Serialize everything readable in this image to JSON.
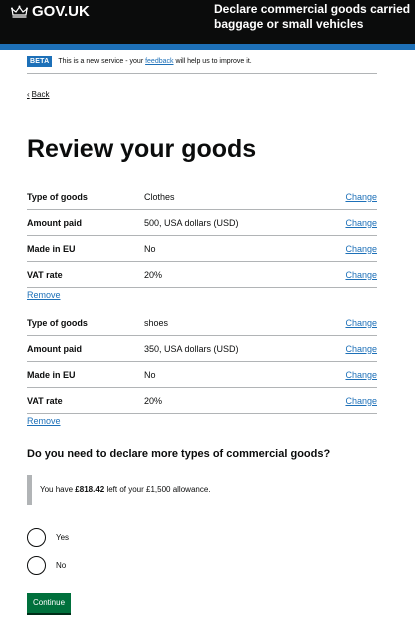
{
  "header": {
    "logo_text": "GOV.UK",
    "service_name_line1": "Declare commercial goods carried",
    "service_name_line2": "baggage or small vehicles"
  },
  "phase_banner": {
    "tag": "BETA",
    "text_before": "This is a new service - your ",
    "link": "feedback",
    "text_after": " will help us to improve it."
  },
  "back_link": "Back",
  "page_title": "Review your goods",
  "goods": [
    {
      "rows": [
        {
          "key": "Type of goods",
          "value": "Clothes",
          "action": "Change"
        },
        {
          "key": "Amount paid",
          "value": "500, USA dollars (USD)",
          "action": "Change"
        },
        {
          "key": "Made in EU",
          "value": "No",
          "action": "Change"
        },
        {
          "key": "VAT rate",
          "value": "20%",
          "action": "Change"
        }
      ],
      "remove": "Remove"
    },
    {
      "rows": [
        {
          "key": "Type of goods",
          "value": "shoes",
          "action": "Change"
        },
        {
          "key": "Amount paid",
          "value": "350, USA dollars (USD)",
          "action": "Change"
        },
        {
          "key": "Made in EU",
          "value": "No",
          "action": "Change"
        },
        {
          "key": "VAT rate",
          "value": "20%",
          "action": "Change"
        }
      ],
      "remove": "Remove"
    }
  ],
  "question": "Do you need to declare more types of commercial goods?",
  "allowance": {
    "prefix": "You have ",
    "amount": "£818.42",
    "suffix": " left of your £1,500 allowance."
  },
  "radios": [
    {
      "label": "Yes"
    },
    {
      "label": "No"
    }
  ],
  "continue_button": "Continue",
  "colors": {
    "header_bg": "#0b0c0c",
    "brand_blue": "#1d70b8",
    "button_green": "#00703c"
  }
}
